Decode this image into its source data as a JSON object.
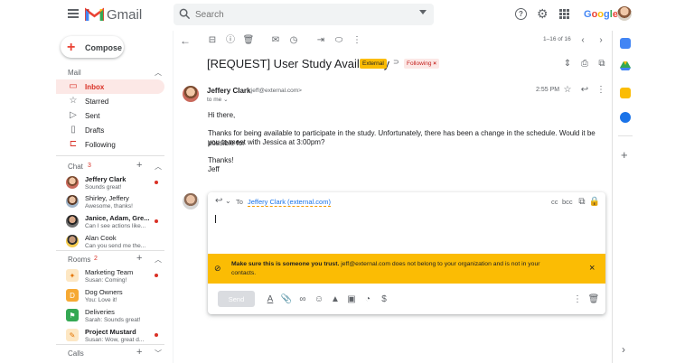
{
  "app": {
    "name": "Gmail",
    "account_brand": "Google"
  },
  "search": {
    "placeholder": "Search"
  },
  "compose": {
    "label": "Compose"
  },
  "mail": {
    "section_label": "Mail",
    "items": [
      {
        "label": "Inbox",
        "icon": "inbox-icon",
        "active": true
      },
      {
        "label": "Starred",
        "icon": "star-icon"
      },
      {
        "label": "Sent",
        "icon": "send-icon"
      },
      {
        "label": "Drafts",
        "icon": "draft-icon"
      },
      {
        "label": "Following",
        "icon": "label-icon"
      }
    ]
  },
  "chat": {
    "section_label": "Chat",
    "count": "3",
    "items": [
      {
        "name": "Jeffery Clark",
        "preview": "Sounds great!",
        "unread": true
      },
      {
        "name": "Shirley, Jeffery",
        "preview": "Awesome, thanks!",
        "unread": false
      },
      {
        "name": "Janice, Adam, Gre...",
        "preview": "Can I see actions like...",
        "unread": true
      },
      {
        "name": "Alan Cook",
        "preview": "Can you send me the...",
        "unread": false
      }
    ]
  },
  "rooms": {
    "section_label": "Rooms",
    "count": "2",
    "items": [
      {
        "name": "Marketing Team",
        "preview": "Susan: Coming!",
        "unread": true,
        "color": "#fbbc04",
        "letter": ""
      },
      {
        "name": "Dog Owners",
        "preview": "You: Love it!",
        "unread": false,
        "color": "#f6a933",
        "letter": "D"
      },
      {
        "name": "Deliveries",
        "preview": "Sarah: Sounds great!",
        "unread": false,
        "color": "#34a853",
        "letter": ""
      },
      {
        "name": "Project Mustard",
        "preview": "Susan: Wow, great d...",
        "unread": true,
        "color": "#e37400",
        "letter": ""
      }
    ]
  },
  "calls": {
    "section_label": "Calls"
  },
  "toolbar": {
    "pagination": "1–16 of 16"
  },
  "email": {
    "subject": "[REQUEST] User Study Availability",
    "external_badge": "External",
    "following_label": "Following",
    "following_close": "×",
    "sender_name": "Jeffery Clark",
    "sender_email": "<jeff@external.com>",
    "recipient_line": "to me",
    "time": "2:55 PM",
    "greeting": "Hi there,",
    "body_line1": "Thanks for being available to participate in the study. Unfortunately, there has been a change in the schedule. Would it be possible for",
    "body_line2": "you to meet with Jessica at 3:00pm?",
    "signoff": "Thanks!",
    "signature": "Jeff"
  },
  "reply": {
    "to_label": "To",
    "recipient": "Jeffery Clark (external.com)",
    "cc": "cc",
    "bcc": "bcc",
    "warning_bold": "Make sure this is someone you trust.",
    "warning_rest": " jeff@external.com does not belong to your organization and is not in your contacts.",
    "warning_close": "×",
    "send_label": "Send"
  },
  "colors": {
    "accent_red": "#d93025",
    "active_nav_bg": "#fce8e6",
    "warning_yellow": "#fbbc04",
    "link_blue": "#1a73e8"
  }
}
